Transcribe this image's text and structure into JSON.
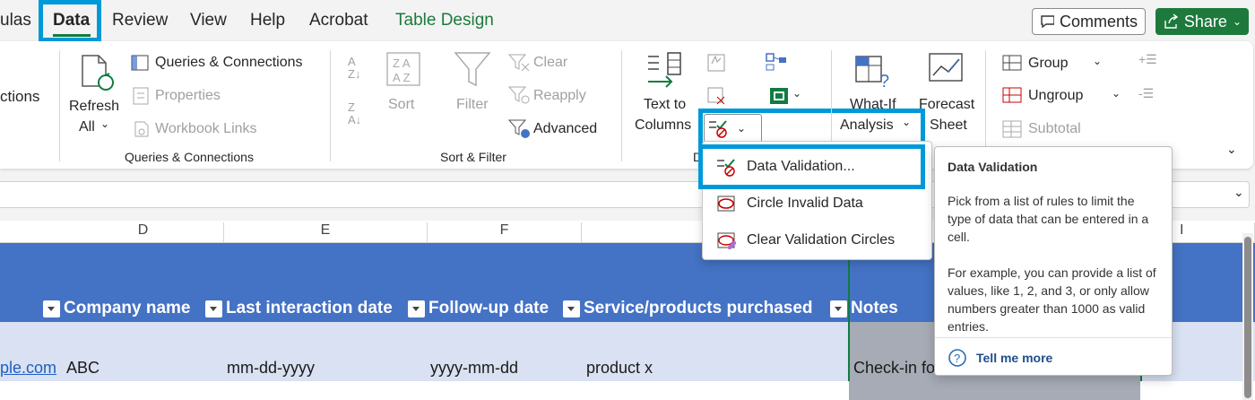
{
  "tabs": [
    {
      "label": "ulas"
    },
    {
      "label": "Data"
    },
    {
      "label": "Review"
    },
    {
      "label": "View"
    },
    {
      "label": "Help"
    },
    {
      "label": "Acrobat"
    },
    {
      "label": "Table Design"
    }
  ],
  "header": {
    "comments_label": "Comments",
    "share_label": "Share"
  },
  "ribbon": {
    "partial_label": "ctions",
    "refresh_line1": "Refresh",
    "refresh_line2": "All",
    "queries_connections": "Queries & Connections",
    "properties": "Properties",
    "workbook_links": "Workbook Links",
    "group_queries": "Queries & Connections",
    "sort": "Sort",
    "filter": "Filter",
    "clear": "Clear",
    "reapply": "Reapply",
    "advanced": "Advanced",
    "group_sort_filter": "Sort & Filter",
    "text_to_line1": "Text to",
    "text_to_line2": "Columns",
    "group_data_tools_partial": "D",
    "whatif_line1": "What-If",
    "whatif_line2": "Analysis",
    "forecast_line1": "Forecast",
    "forecast_line2": "Sheet",
    "group": "Group",
    "ungroup": "Ungroup",
    "subtotal": "Subtotal"
  },
  "menu": {
    "items": [
      {
        "label": "Data Validation...",
        "icon": "data-validation-icon"
      },
      {
        "label": "Circle Invalid Data",
        "icon": "circle-invalid-icon"
      },
      {
        "label": "Clear Validation Circles",
        "icon": "clear-circles-icon"
      }
    ]
  },
  "tooltip": {
    "title": "Data Validation",
    "p1": "Pick from a list of rules to limit the type of data that can be entered in a cell.",
    "p2": "For example, you can provide a list of values, like 1, 2, and 3, or only allow numbers greater than 1000 as valid entries.",
    "link": "Tell me more"
  },
  "grid": {
    "columns": [
      "D",
      "E",
      "F",
      "I"
    ],
    "headers": [
      "Company name",
      "Last interaction date",
      "Follow-up date",
      "Service/products purchased",
      "Notes"
    ],
    "row1": [
      "ple.com",
      "ABC",
      "mm-dd-yyyy",
      "yyyy-mm-dd",
      "product x",
      "Check-in fo"
    ]
  },
  "colors": {
    "accent_green": "#107c41",
    "highlight": "#0099d8",
    "table_header": "#4472c4",
    "row_band": "#d9e1f2"
  }
}
